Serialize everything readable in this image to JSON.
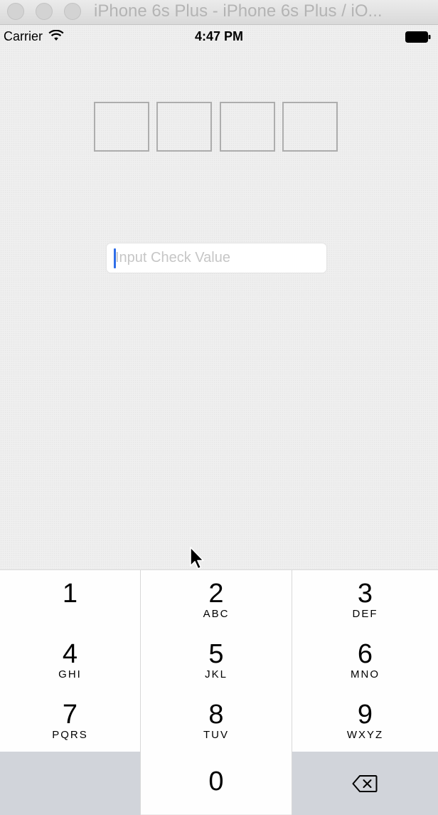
{
  "window": {
    "title": "iPhone 6s Plus - iPhone 6s Plus / iO..."
  },
  "status_bar": {
    "carrier": "Carrier",
    "time": "4:47 PM"
  },
  "code_boxes": [
    "",
    "",
    "",
    ""
  ],
  "check_input": {
    "value": "",
    "placeholder": "Input Check Value"
  },
  "keypad": {
    "keys": [
      {
        "digit": "1",
        "letters": ""
      },
      {
        "digit": "2",
        "letters": "ABC"
      },
      {
        "digit": "3",
        "letters": "DEF"
      },
      {
        "digit": "4",
        "letters": "GHI"
      },
      {
        "digit": "5",
        "letters": "JKL"
      },
      {
        "digit": "6",
        "letters": "MNO"
      },
      {
        "digit": "7",
        "letters": "PQRS"
      },
      {
        "digit": "8",
        "letters": "TUV"
      },
      {
        "digit": "9",
        "letters": "WXYZ"
      },
      {
        "digit": "0",
        "letters": ""
      }
    ]
  },
  "colors": {
    "caret": "#2f6ee8",
    "keypad_function_bg": "#d1d4da"
  }
}
